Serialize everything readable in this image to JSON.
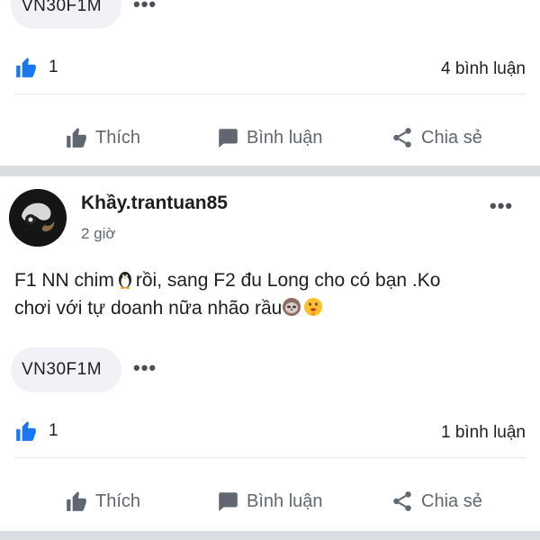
{
  "post1": {
    "tag": "VN30F1M",
    "like_count": "1",
    "comment_count": "4 bình luận"
  },
  "actions": {
    "like_label": "Thích",
    "comment_label": "Bình luận",
    "share_label": "Chia sẻ"
  },
  "post2": {
    "author": "Khầy.trantuan85",
    "time": "2 giờ",
    "text_line1_a": "F1 NN chim",
    "text_line1_b": "rồi, sang F2 đu Long cho có bạn .Ko",
    "text_line2": "chơi với tự doanh nữa nhão rầu",
    "tag": "VN30F1M",
    "like_count": "1",
    "comment_count": "1 bình luận"
  },
  "colors": {
    "like_blue": "#1877f2",
    "action_gray": "#606770",
    "separator": "#dadde1"
  }
}
